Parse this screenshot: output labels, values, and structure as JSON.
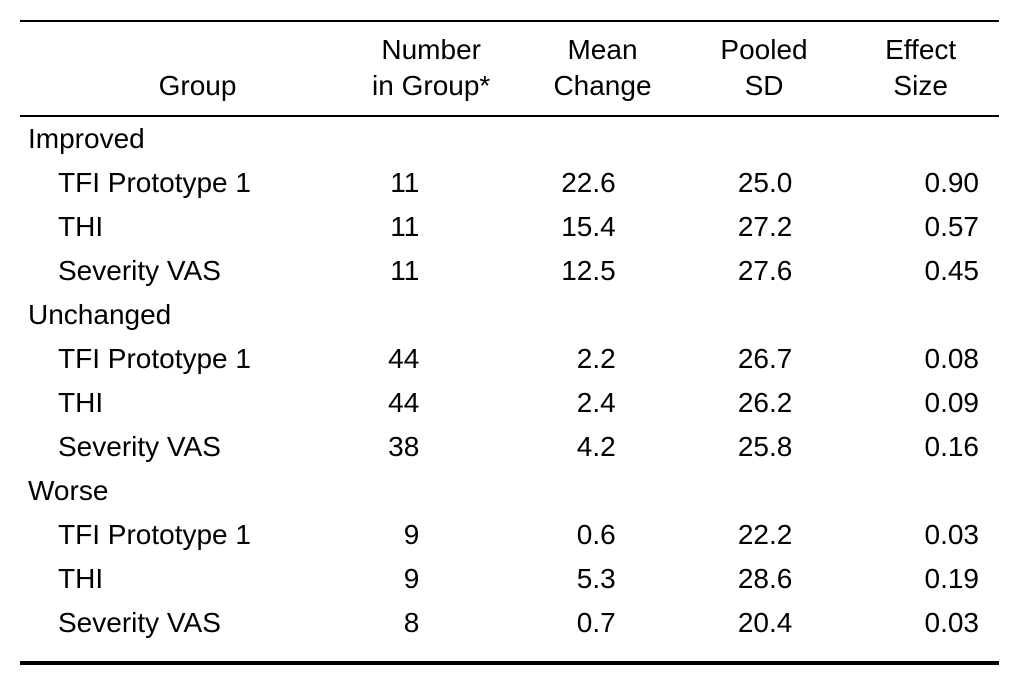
{
  "headers": {
    "group": "Group",
    "number_l1": "Number",
    "number_l2": "in Group*",
    "mean_l1": "Mean",
    "mean_l2": "Change",
    "sd_l1": "Pooled",
    "sd_l2": "SD",
    "es_l1": "Effect",
    "es_l2": "Size"
  },
  "sections": [
    {
      "name": "Improved",
      "rows": [
        {
          "label": "TFI Prototype 1",
          "n": "11",
          "mean": "22.6",
          "sd": "25.0",
          "es": "0.90"
        },
        {
          "label": "THI",
          "n": "11",
          "mean": "15.4",
          "sd": "27.2",
          "es": "0.57"
        },
        {
          "label": "Severity VAS",
          "n": "11",
          "mean": "12.5",
          "sd": "27.6",
          "es": "0.45"
        }
      ]
    },
    {
      "name": "Unchanged",
      "rows": [
        {
          "label": "TFI Prototype 1",
          "n": "44",
          "mean": "2.2",
          "sd": "26.7",
          "es": "0.08"
        },
        {
          "label": "THI",
          "n": "44",
          "mean": "2.4",
          "sd": "26.2",
          "es": "0.09"
        },
        {
          "label": "Severity VAS",
          "n": "38",
          "mean": "4.2",
          "sd": "25.8",
          "es": "0.16"
        }
      ]
    },
    {
      "name": "Worse",
      "rows": [
        {
          "label": "TFI Prototype 1",
          "n": "9",
          "mean": "0.6",
          "sd": "22.2",
          "es": "0.03"
        },
        {
          "label": "THI",
          "n": "9",
          "mean": "5.3",
          "sd": "28.6",
          "es": "0.19"
        },
        {
          "label": "Severity VAS",
          "n": "8",
          "mean": "0.7",
          "sd": "20.4",
          "es": "0.03"
        }
      ]
    }
  ]
}
